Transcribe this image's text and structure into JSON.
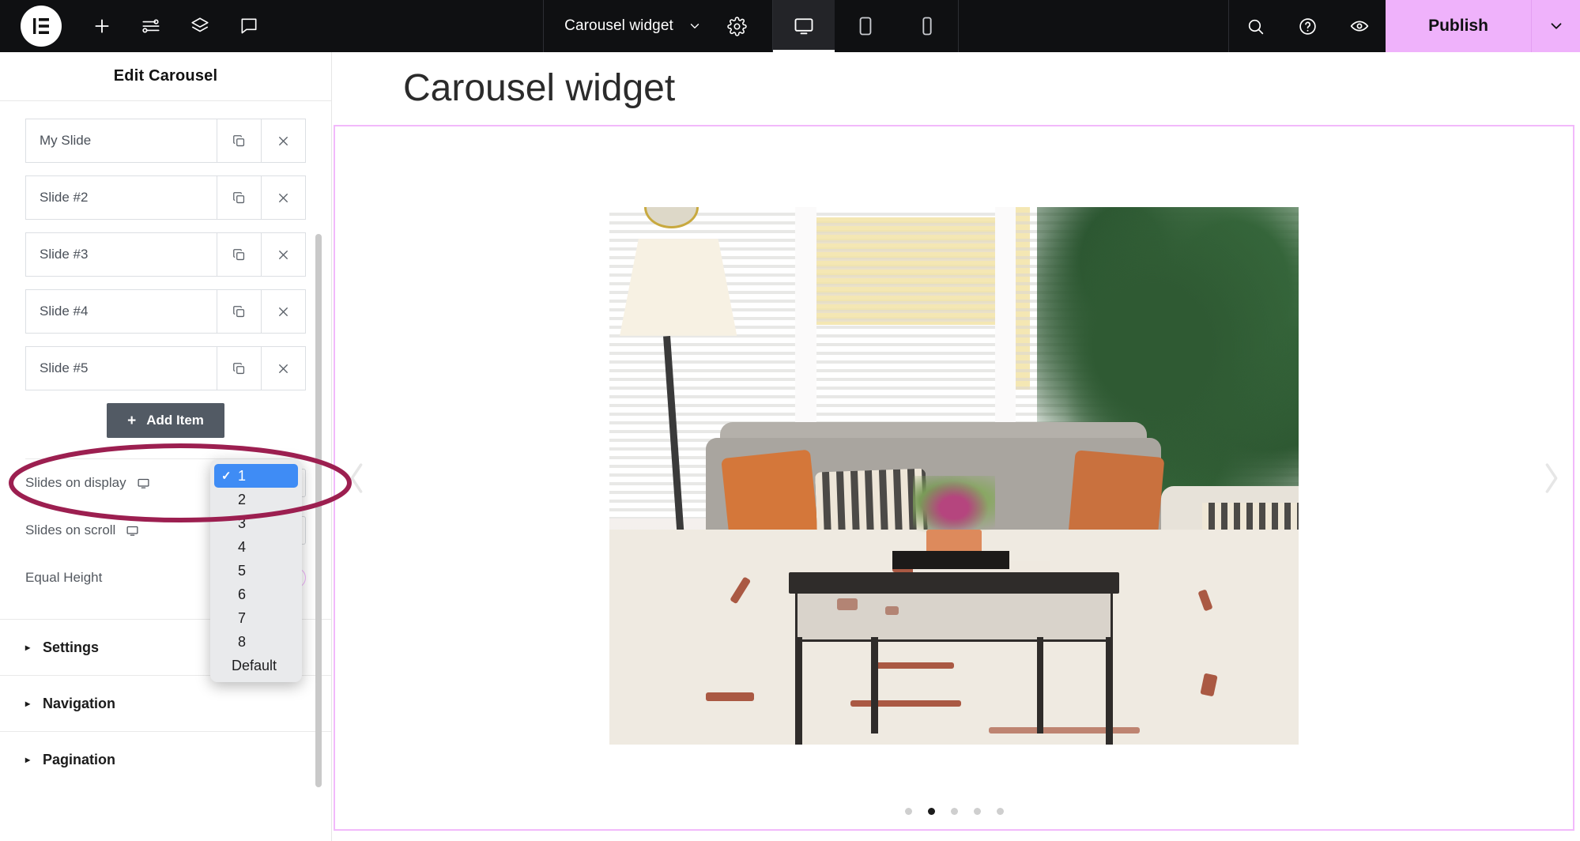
{
  "topbar": {
    "logo_icon": "elementor-logo-icon",
    "icons": [
      {
        "name": "add-element-icon",
        "glyph": "plus"
      },
      {
        "name": "site-settings-sliders-icon",
        "glyph": "sliders"
      },
      {
        "name": "structure-layers-icon",
        "glyph": "layers"
      },
      {
        "name": "comments-icon",
        "glyph": "chat-bubble"
      }
    ],
    "document_title": "Carousel widget",
    "document_caret_icon": "chevron-down-icon",
    "settings_icon": "gear-icon",
    "devices": [
      {
        "name": "device-desktop",
        "label": "Desktop",
        "icon": "monitor-icon",
        "active": true
      },
      {
        "name": "device-tablet",
        "label": "Tablet",
        "icon": "tablet-icon",
        "active": false
      },
      {
        "name": "device-mobile",
        "label": "Mobile",
        "icon": "mobile-icon",
        "active": false
      }
    ],
    "right_icons": [
      {
        "name": "search-icon",
        "glyph": "magnifier"
      },
      {
        "name": "help-icon",
        "glyph": "question-circle"
      },
      {
        "name": "preview-icon",
        "glyph": "eye"
      }
    ],
    "publish_label": "Publish",
    "publish_caret_icon": "chevron-down-icon",
    "publish_color": "#efb2fb"
  },
  "sidebar": {
    "panel_title": "Edit Carousel",
    "slides": [
      {
        "label": "My Slide",
        "duplicate_icon": "duplicate-icon",
        "remove_icon": "close-icon"
      },
      {
        "label": "Slide #2",
        "duplicate_icon": "duplicate-icon",
        "remove_icon": "close-icon"
      },
      {
        "label": "Slide #3",
        "duplicate_icon": "duplicate-icon",
        "remove_icon": "close-icon"
      },
      {
        "label": "Slide #4",
        "duplicate_icon": "duplicate-icon",
        "remove_icon": "close-icon"
      },
      {
        "label": "Slide #5",
        "duplicate_icon": "duplicate-icon",
        "remove_icon": "close-icon"
      }
    ],
    "add_item_label": "Add Item",
    "add_item_plus": "+",
    "controls": [
      {
        "name": "slides-on-display",
        "label": "Slides on display",
        "responsive_icon": "monitor-icon",
        "type": "select",
        "value": "1"
      },
      {
        "name": "slides-on-scroll",
        "label": "Slides on scroll",
        "responsive_icon": "monitor-icon",
        "type": "select",
        "value": ""
      },
      {
        "name": "equal-height",
        "label": "Equal Height",
        "responsive_icon": "",
        "type": "toggle",
        "value": "off"
      }
    ],
    "sections": [
      {
        "name": "settings",
        "label": "Settings",
        "arrow": "▸"
      },
      {
        "name": "navigation",
        "label": "Navigation",
        "arrow": "▸"
      },
      {
        "name": "pagination",
        "label": "Pagination",
        "arrow": "▸"
      }
    ]
  },
  "dropdown": {
    "name": "slides-on-display-dropdown",
    "selected_value": "1",
    "check_glyph": "✓",
    "highlight_color": "#3f8cf5",
    "options": [
      "1",
      "2",
      "3",
      "4",
      "5",
      "6",
      "7",
      "8",
      "Default"
    ]
  },
  "annotation": {
    "name": "highlight-ellipse",
    "shape": "ellipse",
    "color": "#9c1f50",
    "target": "Slides on display"
  },
  "canvas": {
    "page_heading": "Carousel widget",
    "widget_border_color": "#f2b9fb",
    "prev_arrow_icon": "chevron-left-icon",
    "next_arrow_icon": "chevron-right-icon",
    "slide_alt": "living-room-sofa-photo",
    "pagination_dots": 5,
    "pagination_active_index": 1
  }
}
